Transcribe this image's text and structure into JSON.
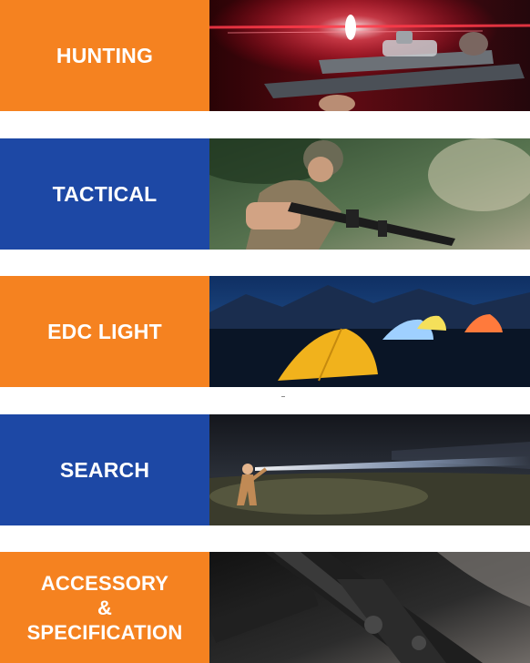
{
  "categories": [
    {
      "label": "HUNTING",
      "accent": "#f58220",
      "photo_icon": "rifle-scope-photo"
    },
    {
      "label": "TACTICAL",
      "accent": "#1d48a5",
      "photo_icon": "soldier-rifle-photo"
    },
    {
      "label": "EDC LIGHT",
      "accent": "#f58220",
      "photo_icon": "camping-tents-photo"
    },
    {
      "label": "SEARCH",
      "accent": "#1d48a5",
      "photo_icon": "flashlight-beam-photo"
    },
    {
      "label": "ACCESSORY\n&\nSPECIFICATION",
      "accent": "#f58220",
      "photo_icon": "weapon-light-photo"
    }
  ]
}
